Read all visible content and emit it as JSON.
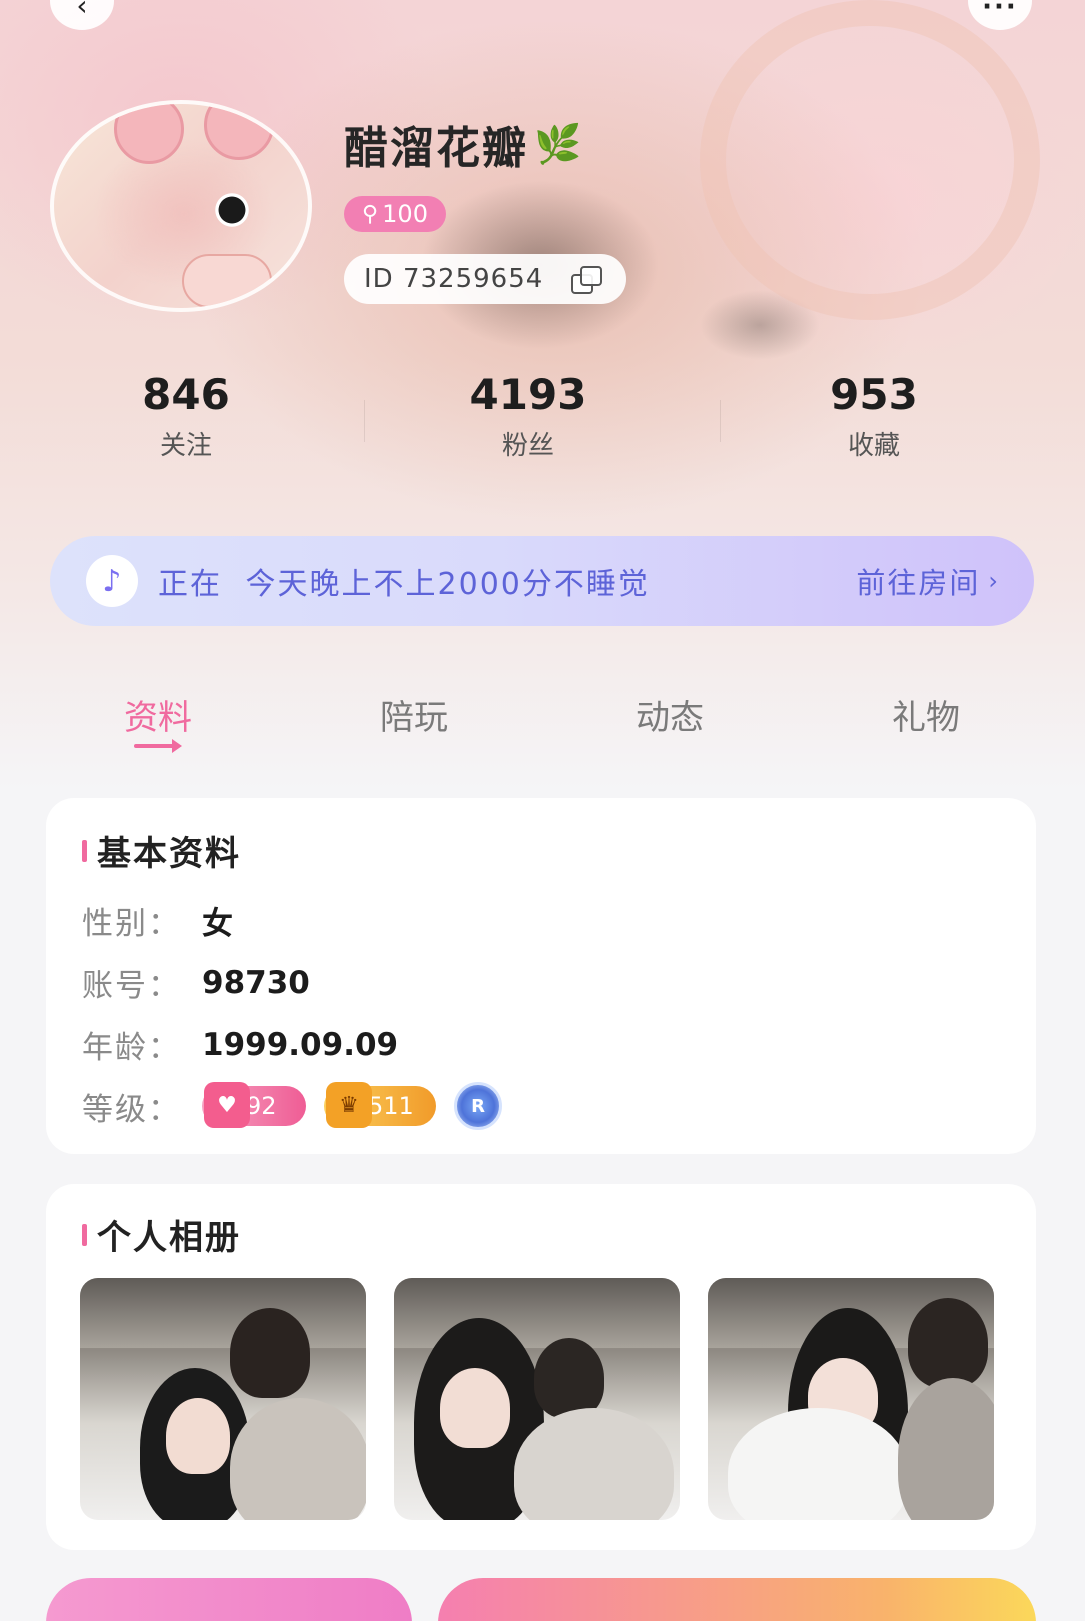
{
  "header": {
    "back_icon": "chevron-left-icon",
    "more_icon": "more-dots-icon",
    "more_label": "···"
  },
  "profile": {
    "name": "醋溜花瓣",
    "name_emoji": "🌿",
    "level_icon": "key-icon",
    "level_value": "100",
    "id_text": "ID 73259654",
    "copy_icon": "copy-icon"
  },
  "stats": [
    {
      "value": "846",
      "label": "关注"
    },
    {
      "value": "4193",
      "label": "粉丝"
    },
    {
      "value": "953",
      "label": "收藏"
    }
  ],
  "room": {
    "prefix": "正在",
    "title": "今天晚上不上2000分不睡觉",
    "link": "前往房间",
    "link_chevron": "›"
  },
  "tabs": [
    {
      "label": "资料",
      "active": true
    },
    {
      "label": "陪玩",
      "active": false
    },
    {
      "label": "动态",
      "active": false
    },
    {
      "label": "礼物",
      "active": false
    }
  ],
  "basic_info": {
    "title": "基本资料",
    "rows": [
      {
        "key": "性别：",
        "value": "女"
      },
      {
        "key": "账号：",
        "value": "98730"
      },
      {
        "key": "年龄：",
        "value": "1999.09.09"
      },
      {
        "key": "等级：",
        "value": ""
      }
    ],
    "badges": [
      {
        "kind": "pink",
        "value": "92"
      },
      {
        "kind": "gold",
        "value": "511"
      },
      {
        "kind": "blue",
        "value": "R"
      }
    ]
  },
  "album": {
    "title": "个人相册",
    "photos": [
      "photo-1",
      "photo-2",
      "photo-3"
    ]
  },
  "colors": {
    "accent": "#f06a9f",
    "room_text": "#5d63d8",
    "level_pill": "#f27fb3"
  }
}
